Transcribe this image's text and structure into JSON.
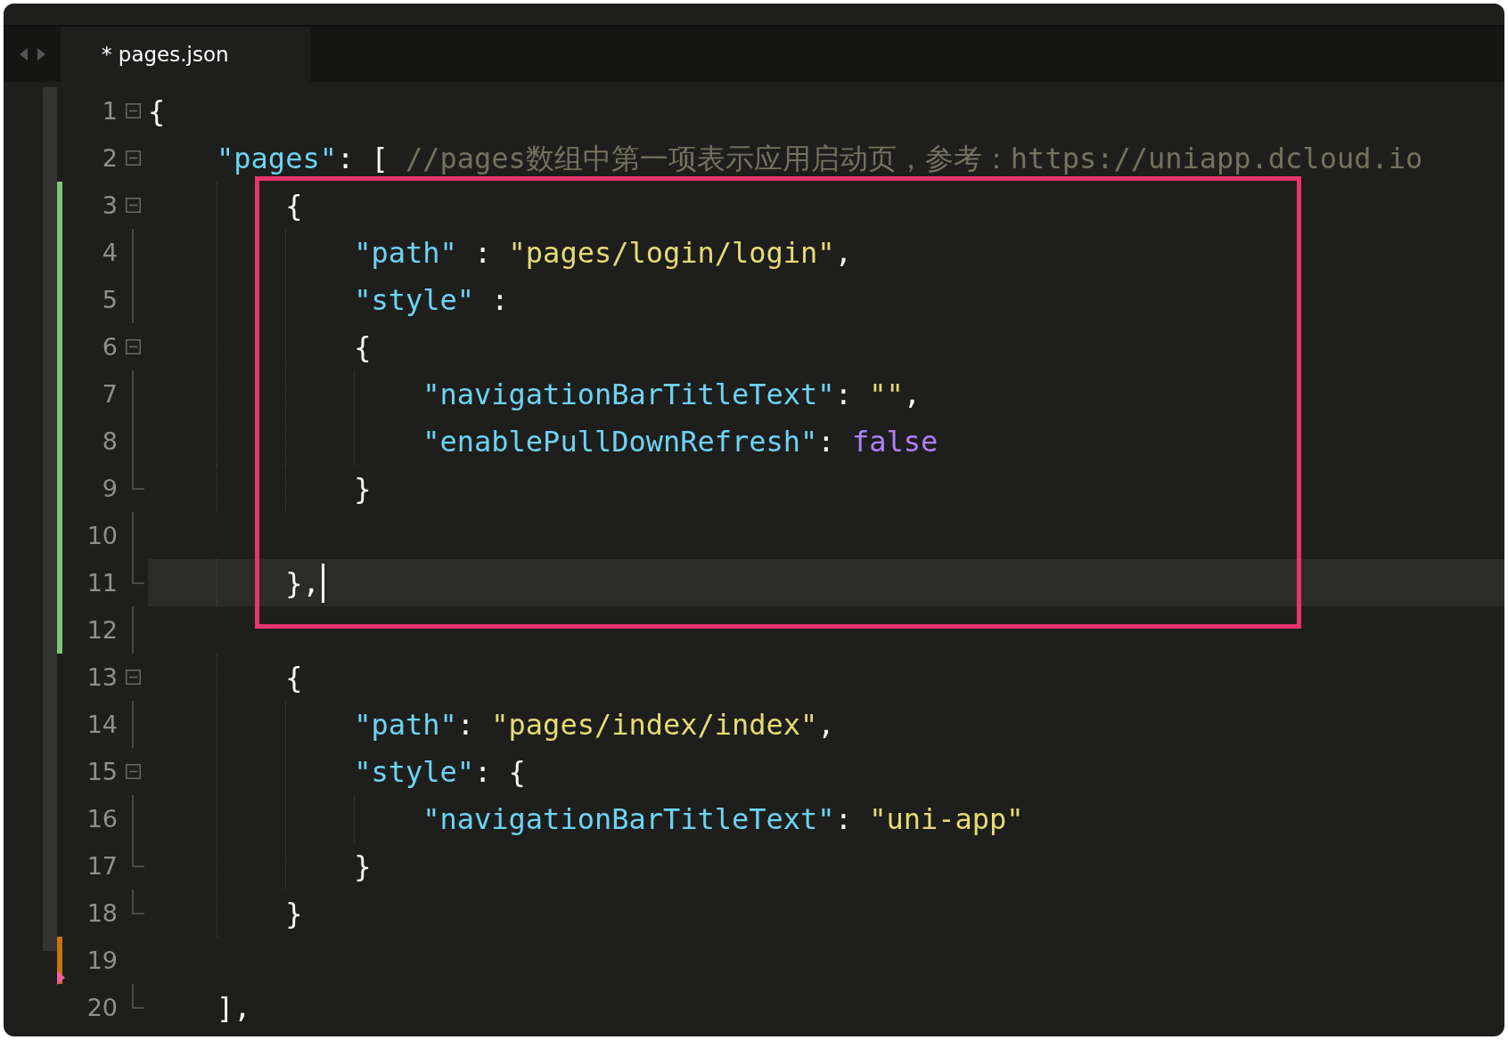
{
  "tab": {
    "label": "* pages.json",
    "selected": true
  },
  "lines": [
    {
      "number": "1",
      "fold_start": true,
      "in_fold": false,
      "fold_end": false,
      "added": false,
      "modified": false,
      "deletion": false,
      "boxed": false,
      "current": false,
      "tokens": [
        {
          "kind": "punct",
          "text": "{"
        }
      ]
    },
    {
      "number": "2",
      "fold_start": true,
      "in_fold": false,
      "fold_end": false,
      "added": false,
      "modified": false,
      "deletion": false,
      "boxed": false,
      "current": false,
      "tokens": [
        {
          "kind": "key",
          "text": "    \"pages\""
        },
        {
          "kind": "punct",
          "text": ": [ "
        },
        {
          "kind": "comment",
          "text": "//pages数组中第一项表示应用启动页，参考：https://uniapp.dcloud.io"
        }
      ]
    },
    {
      "number": "3",
      "fold_start": true,
      "in_fold": false,
      "fold_end": false,
      "added": true,
      "modified": false,
      "deletion": false,
      "boxed": true,
      "current": false,
      "tokens": [
        {
          "kind": "punct",
          "text": "        {"
        }
      ]
    },
    {
      "number": "4",
      "fold_start": false,
      "in_fold": true,
      "fold_end": false,
      "added": true,
      "modified": false,
      "deletion": false,
      "boxed": true,
      "current": false,
      "tokens": [
        {
          "kind": "key",
          "text": "            \"path\""
        },
        {
          "kind": "punct",
          "text": " : "
        },
        {
          "kind": "string",
          "text": "\"pages/login/login\""
        },
        {
          "kind": "punct",
          "text": ","
        }
      ]
    },
    {
      "number": "5",
      "fold_start": false,
      "in_fold": true,
      "fold_end": false,
      "added": true,
      "modified": false,
      "deletion": false,
      "boxed": true,
      "current": false,
      "tokens": [
        {
          "kind": "key",
          "text": "            \"style\""
        },
        {
          "kind": "punct",
          "text": " :"
        }
      ]
    },
    {
      "number": "6",
      "fold_start": true,
      "in_fold": false,
      "fold_end": false,
      "added": true,
      "modified": false,
      "deletion": false,
      "boxed": true,
      "current": false,
      "tokens": [
        {
          "kind": "punct",
          "text": "            {"
        }
      ]
    },
    {
      "number": "7",
      "fold_start": false,
      "in_fold": true,
      "fold_end": false,
      "added": true,
      "modified": false,
      "deletion": false,
      "boxed": true,
      "current": false,
      "tokens": [
        {
          "kind": "key",
          "text": "                \"navigationBarTitleText\""
        },
        {
          "kind": "punct",
          "text": ": "
        },
        {
          "kind": "string",
          "text": "\"\""
        },
        {
          "kind": "punct",
          "text": ","
        }
      ]
    },
    {
      "number": "8",
      "fold_start": false,
      "in_fold": true,
      "fold_end": false,
      "added": true,
      "modified": false,
      "deletion": false,
      "boxed": true,
      "current": false,
      "tokens": [
        {
          "kind": "key",
          "text": "                \"enablePullDownRefresh\""
        },
        {
          "kind": "punct",
          "text": ": "
        },
        {
          "kind": "boolean",
          "text": "false"
        }
      ]
    },
    {
      "number": "9",
      "fold_start": false,
      "in_fold": false,
      "fold_end": true,
      "added": true,
      "modified": false,
      "deletion": false,
      "boxed": true,
      "current": false,
      "tokens": [
        {
          "kind": "punct",
          "text": "            }"
        }
      ]
    },
    {
      "number": "10",
      "fold_start": false,
      "in_fold": true,
      "fold_end": false,
      "added": true,
      "modified": false,
      "deletion": false,
      "boxed": true,
      "current": false
    },
    {
      "number": "11",
      "fold_start": false,
      "in_fold": false,
      "fold_end": true,
      "added": true,
      "modified": false,
      "deletion": false,
      "boxed": true,
      "current": true,
      "tokens": [
        {
          "kind": "punct",
          "text": "        },"
        }
      ]
    },
    {
      "number": "12",
      "fold_start": false,
      "in_fold": true,
      "fold_end": false,
      "added": true,
      "modified": false,
      "deletion": false,
      "boxed": true,
      "current": false
    },
    {
      "number": "13",
      "fold_start": true,
      "in_fold": false,
      "fold_end": false,
      "added": false,
      "modified": false,
      "deletion": false,
      "boxed": false,
      "current": false,
      "tokens": [
        {
          "kind": "punct",
          "text": "        {"
        }
      ]
    },
    {
      "number": "14",
      "fold_start": false,
      "in_fold": true,
      "fold_end": false,
      "added": false,
      "modified": false,
      "deletion": false,
      "boxed": false,
      "current": false,
      "tokens": [
        {
          "kind": "key",
          "text": "            \"path\""
        },
        {
          "kind": "punct",
          "text": ": "
        },
        {
          "kind": "string",
          "text": "\"pages/index/index\""
        },
        {
          "kind": "punct",
          "text": ","
        }
      ]
    },
    {
      "number": "15",
      "fold_start": true,
      "in_fold": false,
      "fold_end": false,
      "added": false,
      "modified": false,
      "deletion": false,
      "boxed": false,
      "current": false,
      "tokens": [
        {
          "kind": "key",
          "text": "            \"style\""
        },
        {
          "kind": "punct",
          "text": ": {"
        }
      ]
    },
    {
      "number": "16",
      "fold_start": false,
      "in_fold": true,
      "fold_end": false,
      "added": false,
      "modified": false,
      "deletion": false,
      "boxed": false,
      "current": false,
      "tokens": [
        {
          "kind": "key",
          "text": "                \"navigationBarTitleText\""
        },
        {
          "kind": "punct",
          "text": ": "
        },
        {
          "kind": "string",
          "text": "\"uni-app\""
        }
      ]
    },
    {
      "number": "17",
      "fold_start": false,
      "in_fold": false,
      "fold_end": true,
      "added": false,
      "modified": false,
      "deletion": false,
      "boxed": false,
      "current": false,
      "tokens": [
        {
          "kind": "punct",
          "text": "            }"
        }
      ]
    },
    {
      "number": "18",
      "fold_start": false,
      "in_fold": false,
      "fold_end": true,
      "added": false,
      "modified": false,
      "deletion": false,
      "boxed": false,
      "current": false,
      "tokens": [
        {
          "kind": "punct",
          "text": "        }"
        }
      ]
    },
    {
      "number": "19",
      "fold_start": false,
      "in_fold": false,
      "fold_end": false,
      "added": false,
      "modified": true,
      "deletion": true,
      "boxed": false,
      "current": false
    },
    {
      "number": "20",
      "fold_start": false,
      "in_fold": false,
      "fold_end": true,
      "added": false,
      "modified": false,
      "deletion": false,
      "boxed": false,
      "current": false,
      "tokens": [
        {
          "kind": "punct",
          "text": "    ],"
        }
      ]
    }
  ]
}
